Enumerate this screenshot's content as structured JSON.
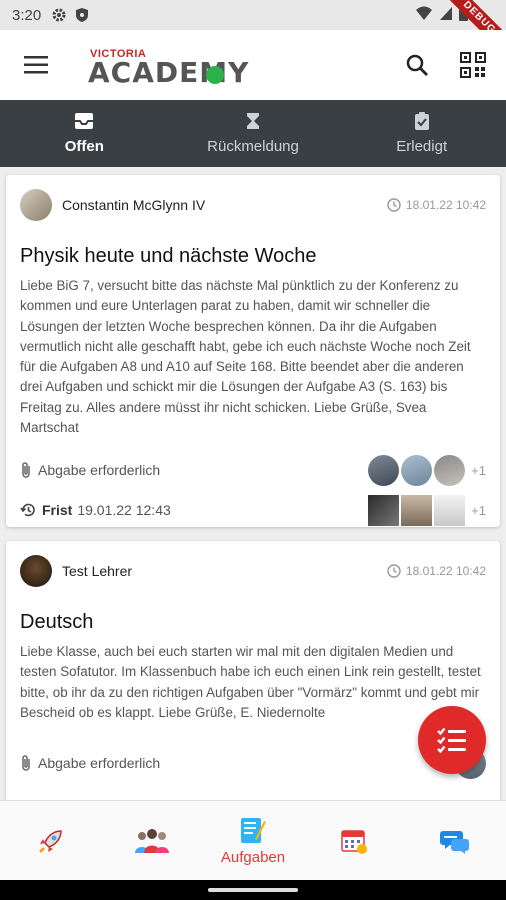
{
  "status": {
    "time": "3:20",
    "debug": "DEBUG"
  },
  "appbar": {
    "logo_small": "VICTORIA",
    "logo_big": "ACADEMY"
  },
  "tabs": [
    {
      "label": "Offen",
      "icon": "inbox-icon"
    },
    {
      "label": "Rückmeldung",
      "icon": "hourglass-icon"
    },
    {
      "label": "Erledigt",
      "icon": "clipboard-check-icon"
    }
  ],
  "cards": [
    {
      "author": "Constantin McGlynn IV",
      "date": "18.01.22 10:42",
      "title": "Physik heute und nächste Woche",
      "body": "Liebe BiG 7, versucht bitte das nächste Mal pünktlich zu der Konferenz zu kommen und eure Unterlagen parat zu haben, damit wir schneller die Lösungen der letzten Woche besprechen können. Da ihr die Aufgaben vermutlich nicht alle geschafft habt, gebe ich euch nächste Woche noch Zeit für die Aufgaben A8 und A10 auf Seite 168. Bitte beendet aber die anderen drei Aufgaben und schickt mir die Lösungen der Aufgabe A3 (S. 163) bis Freitag zu. Alles andere müsst ihr nicht schicken. Liebe Grüße, Svea Martschat",
      "submission": "Abgabe erforderlich",
      "deadline_label": "Frist",
      "deadline": "19.01.22 12:43",
      "plus_recipients": "+1",
      "plus_files": "+1"
    },
    {
      "author": "Test Lehrer",
      "date": "18.01.22 10:42",
      "title": "Deutsch",
      "body": "Liebe Klasse, auch bei euch starten wir mal mit den digitalen Medien und testen Sofatutor. Im Klassenbuch habe ich euch einen Link rein gestellt, testet bitte, ob ihr da zu den richtigen Aufgaben über \"Vormärz\" kommt und gebt mir Bescheid ob es klappt. Liebe Grüße, E. Niedernolte",
      "submission": "Abgabe erforderlich"
    }
  ],
  "bottomnav": [
    {
      "icon": "rocket-icon",
      "label": ""
    },
    {
      "icon": "people-icon",
      "label": ""
    },
    {
      "icon": "assignments-icon",
      "label": "Aufgaben"
    },
    {
      "icon": "calendar-icon",
      "label": ""
    },
    {
      "icon": "chat-icon",
      "label": ""
    }
  ],
  "colors": {
    "accent": "#e53935",
    "tabbar": "#3a3f44",
    "online": "#2bb34a"
  }
}
